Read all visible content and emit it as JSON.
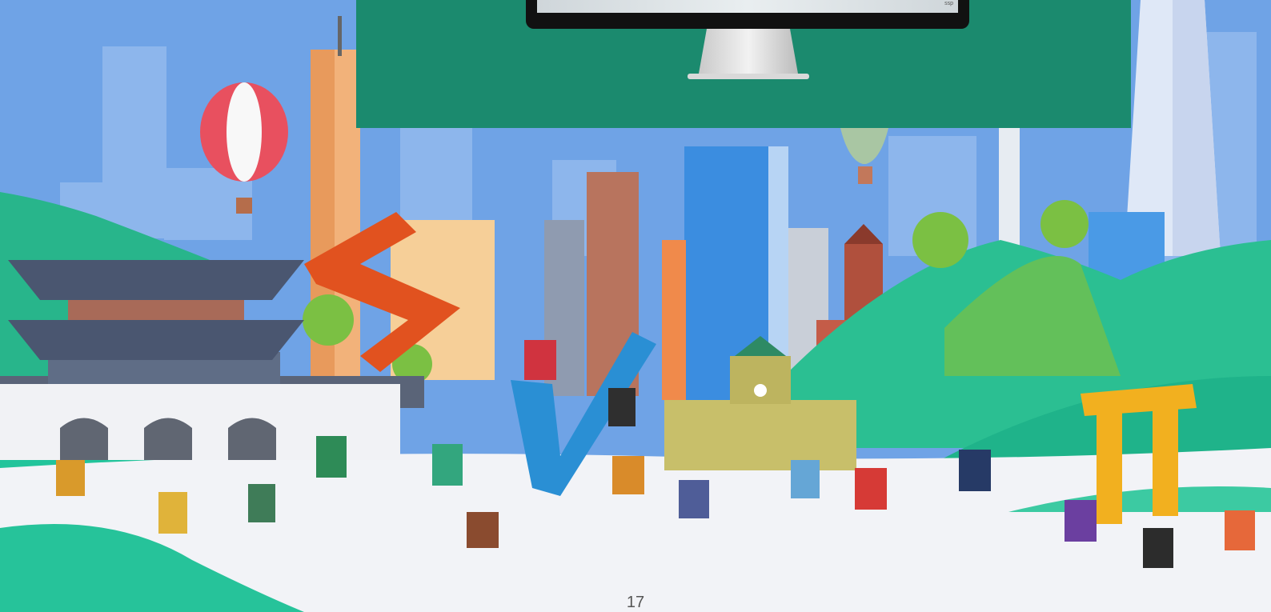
{
  "slide": {
    "page_number": "17",
    "monitor_screen_text": "ssp"
  },
  "colors": {
    "sky": "#6fa3e6",
    "panel": "#1b8a6e",
    "hills": "#2bbf92",
    "ground": "#f2f3f7",
    "logo_s": "#e1521f",
    "logo_w": "#2a8fd4",
    "logo_pi": "#f2b01f"
  }
}
